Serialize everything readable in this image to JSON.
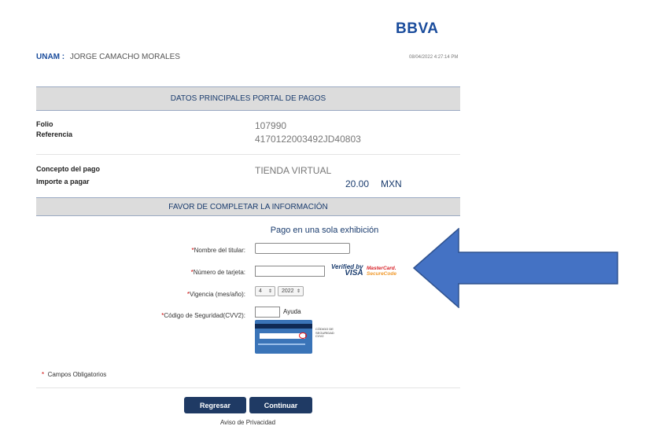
{
  "header": {
    "logo_text": "BBVA",
    "institution": "UNAM :",
    "customer_name": "JORGE CAMACHO MORALES",
    "datetime": "08/04/2022 4:27:14 PM"
  },
  "section_main": {
    "title": "DATOS PRINCIPALES PORTAL DE PAGOS"
  },
  "details": {
    "folio_label": "Folio",
    "folio_value": "107990",
    "referencia_label": "Referencia",
    "referencia_value": "4170122003492JD40803",
    "concepto_label": "Concepto del pago",
    "concepto_value": "TIENDA VIRTUAL",
    "importe_label": "Importe a pagar",
    "importe_value": "20.00",
    "currency": "MXN"
  },
  "section_form": {
    "title": "FAVOR DE COMPLETAR LA INFORMACIÓN"
  },
  "form": {
    "subtitle": "Pago en una sola exhibición",
    "required_mark": "*",
    "name_label": "Nombre del titular:",
    "name_value": "",
    "card_label": "Número de tarjeta:",
    "card_value": "",
    "expiry_label": "Vigencia (mes/año):",
    "expiry_month": "4",
    "expiry_year": "2022",
    "cvv_label": "Código de Seguridad(CVV2):",
    "cvv_value": "",
    "help_label": "Ayuda",
    "visa_line1": "Verified by",
    "visa_line2": "VISA",
    "mc_line1": "MasterCard.",
    "mc_line2": "SecureCode",
    "cvv_note_1": "CÓDIGO DE",
    "cvv_note_2": "SEGURIDAD",
    "cvv_note_3": "CVV2"
  },
  "footer": {
    "required_note": "Campos Obligatorios",
    "back_label": "Regresar",
    "continue_label": "Continuar",
    "privacy_label": "Aviso de Privacidad"
  },
  "annotation": {
    "arrow_color": "#4472c4",
    "arrow_direction": "left"
  }
}
